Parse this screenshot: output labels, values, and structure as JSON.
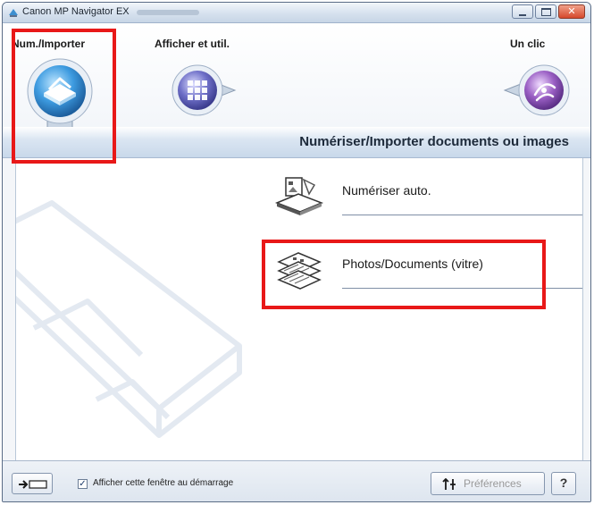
{
  "window": {
    "title": "Canon MP Navigator EX",
    "close_glyph": "✕"
  },
  "nav": {
    "scan_import_label": "Num./Importer",
    "view_use_label": "Afficher et util.",
    "one_click_label": "Un clic"
  },
  "header": {
    "title": "Numériser/Importer documents ou images"
  },
  "menu": {
    "auto_scan_label": "Numériser auto.",
    "photos_docs_label": "Photos/Documents (vitre)"
  },
  "footer": {
    "show_on_startup_label": "Afficher cette fenêtre au démarrage",
    "show_on_startup_checked": true,
    "check_glyph": "✓",
    "preferences_label": "Préférences",
    "help_label": "?"
  },
  "icons": {
    "scan_import": "scanner-icon",
    "view_use": "grid-icon",
    "one_click": "one-click-icon",
    "auto_scan": "auto-scan-icon",
    "photos_docs": "photos-documents-icon",
    "expand": "expand-arrow-icon",
    "preferences": "preferences-icon"
  },
  "colors": {
    "highlight": "#e81818",
    "accent_blue": "#3d8fd0",
    "accent_purple": "#8c55b5",
    "accent_indigo": "#5a5bb0"
  }
}
